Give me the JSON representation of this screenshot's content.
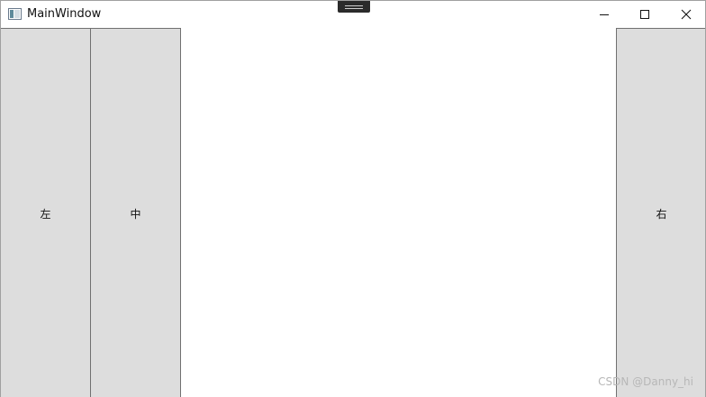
{
  "window": {
    "title": "MainWindow",
    "controls": {
      "minimize": "minimize-icon",
      "maximize": "maximize-icon",
      "close": "close-icon"
    }
  },
  "panels": {
    "left_label": "左",
    "middle_label": "中",
    "right_label": "右"
  },
  "watermark": "CSDN @Danny_hi",
  "colors": {
    "panel_bg": "#dddddd",
    "panel_border": "#707070",
    "window_bg": "#ffffff"
  }
}
